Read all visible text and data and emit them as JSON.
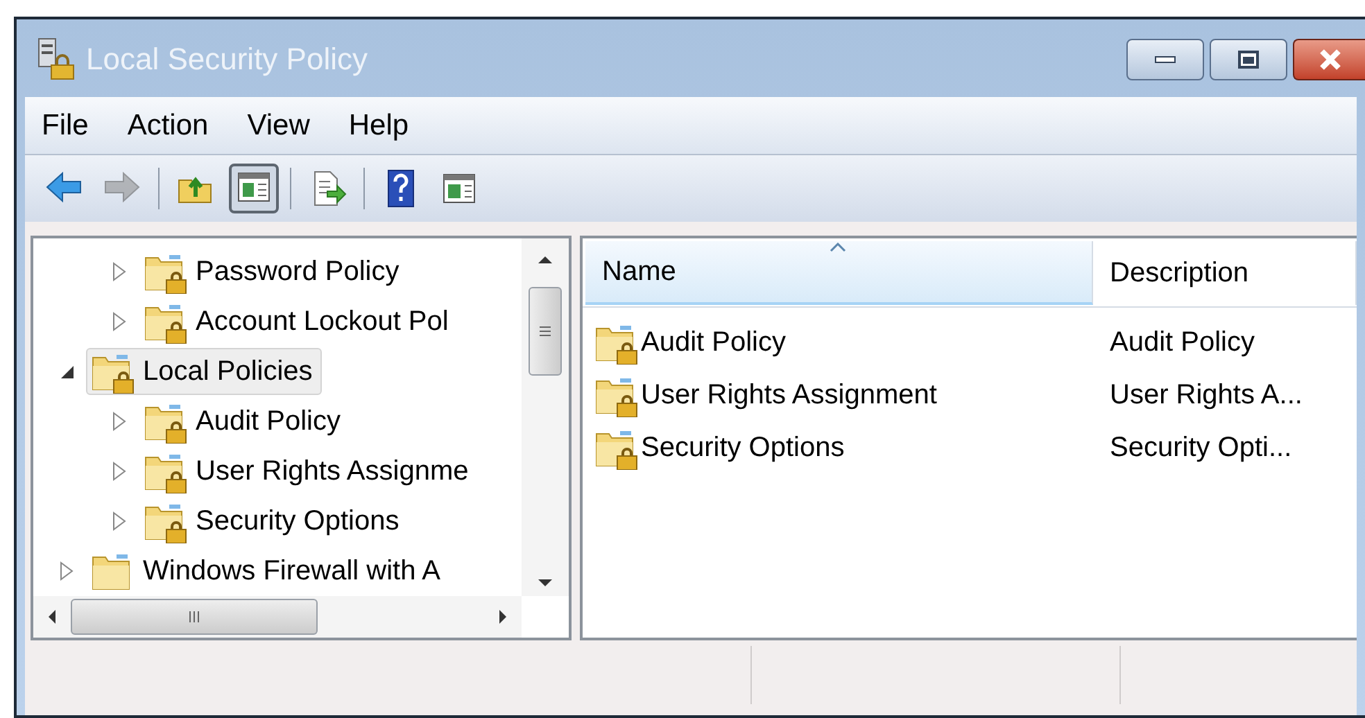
{
  "window": {
    "title": "Local Security Policy"
  },
  "menu": [
    "File",
    "Action",
    "View",
    "Help"
  ],
  "toolbar": [
    {
      "kind": "back",
      "disabled": false
    },
    {
      "kind": "forward",
      "disabled": true
    },
    {
      "kind": "separator"
    },
    {
      "kind": "up",
      "disabled": false
    },
    {
      "kind": "tree-toggle",
      "pressed": true
    },
    {
      "kind": "separator"
    },
    {
      "kind": "export",
      "disabled": false
    },
    {
      "kind": "separator"
    },
    {
      "kind": "help",
      "disabled": false
    },
    {
      "kind": "action-pane",
      "pressed": false
    }
  ],
  "tree": [
    {
      "children": [
        {
          "label": "Password Policy",
          "locked": true,
          "expanded": false,
          "selected": false
        },
        {
          "label": "Account Lockout Pol",
          "locked": true,
          "expanded": false,
          "selected": false
        }
      ]
    },
    {
      "label": "Local Policies",
      "locked": true,
      "expanded": true,
      "selected": true,
      "children": [
        {
          "label": "Audit Policy",
          "locked": true,
          "expanded": false,
          "selected": false
        },
        {
          "label": "User Rights Assignme",
          "locked": true,
          "expanded": false,
          "selected": false
        },
        {
          "label": "Security Options",
          "locked": true,
          "expanded": false,
          "selected": false
        }
      ]
    },
    {
      "label": "Windows Firewall with A",
      "locked": false,
      "expanded": false,
      "selected": false
    }
  ],
  "list": {
    "columns": [
      {
        "label": "Name",
        "sorted": true
      },
      {
        "label": "Description",
        "sorted": false
      }
    ],
    "rows": [
      {
        "name": "Audit Policy",
        "description": "Audit Policy"
      },
      {
        "name": "User Rights Assignment",
        "description": "User Rights A..."
      },
      {
        "name": "Security Options",
        "description": "Security Opti..."
      }
    ]
  }
}
